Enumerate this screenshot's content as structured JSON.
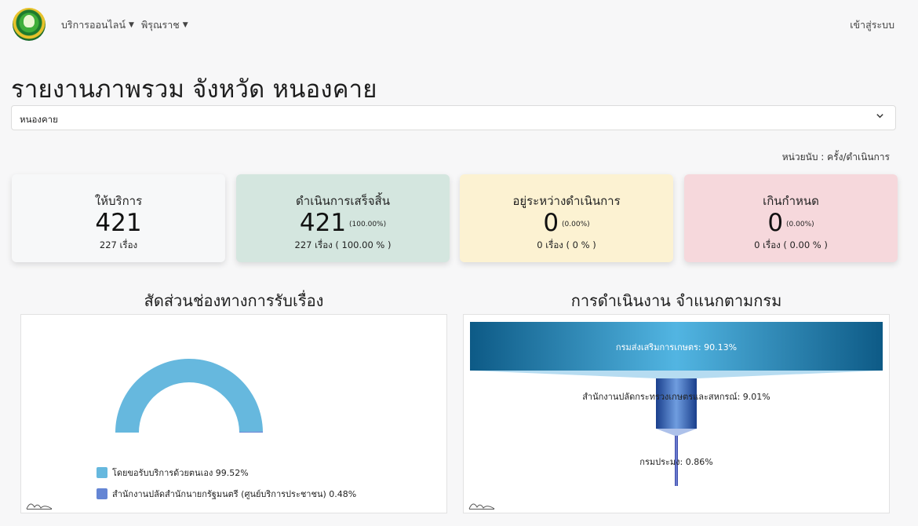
{
  "header": {
    "nav": [
      {
        "label": "บริการออนไลน์"
      },
      {
        "label": "พิรุณราช"
      }
    ],
    "login_label": "เข้าสู่ระบบ"
  },
  "page": {
    "title": "รายงานภาพรวม จังหวัด หนองคาย",
    "province_select": "หนองคาย",
    "unit_text": "หน่วยนับ : ครั้ง/ดำเนินการ"
  },
  "cards": [
    {
      "label": "ให้บริการ",
      "value": "421",
      "pct": "",
      "sub": "227 เรื่อง",
      "color": "#f7f8f9"
    },
    {
      "label": "ดำเนินการเสร็จสิ้น",
      "value": "421",
      "pct": "(100.00%)",
      "sub": "227 เรื่อง ( 100.00 % )",
      "color": "#d4e6df"
    },
    {
      "label": "อยู่ระหว่างดำเนินการ",
      "value": "0",
      "pct": "(0.00%)",
      "sub": "0 เรื่อง ( 0 % )",
      "color": "#fcf2d2"
    },
    {
      "label": "เกินกำหนด",
      "value": "0",
      "pct": "(0.00%)",
      "sub": "0 เรื่อง ( 0.00 % )",
      "color": "#f6d8dc"
    }
  ],
  "chart_data": [
    {
      "type": "pie",
      "variant": "semi-donut",
      "title": "สัดส่วนช่องทางการรับเรื่อง",
      "series": [
        {
          "name": "โดยขอรับบริการด้วยตนเอง",
          "value": 99.52,
          "label": "โดยขอรับบริการด้วยตนเอง 99.52%",
          "color": "#66b8de"
        },
        {
          "name": "สำนักงานปลัดสำนักนายกรัฐมนตรี (ศูนย์บริการประชาชน)",
          "value": 0.48,
          "label": "สำนักงานปลัดสำนักนายกรัฐมนตรี (ศูนย์บริการประชาชน) 0.48%",
          "color": "#6485d4"
        }
      ],
      "legend": "bottom-left"
    },
    {
      "type": "bar",
      "variant": "funnel",
      "title": "การดำเนินงาน จำแนกตามกรม",
      "categories": [
        "กรมส่งเสริมการเกษตร",
        "สำนักงานปลัดกระทรวงเกษตรและสหกรณ์",
        "กรมประมง"
      ],
      "values": [
        90.13,
        9.01,
        0.86
      ],
      "labels": [
        "กรมส่งเสริมการเกษตร: 90.13%",
        "สำนักงานปลัดกระทรวงเกษตรและสหกรณ์: 9.01%",
        "กรมประมง: 0.86%"
      ],
      "colors": [
        "#1f78b4",
        "#2f5fae",
        "#3f4fb0"
      ]
    }
  ],
  "icons": {
    "logo": "agency-logo-icon",
    "caret": "caret-down-icon",
    "chevron": "chevron-down-icon",
    "watermark": "chart-watermark-icon"
  }
}
